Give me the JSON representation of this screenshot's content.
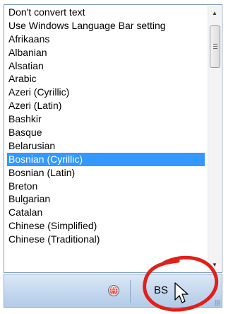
{
  "language_list": {
    "items": [
      "Don't convert text",
      "Use Windows Language Bar setting",
      "Afrikaans",
      "Albanian",
      "Alsatian",
      "Arabic",
      "Azeri (Cyrillic)",
      "Azeri (Latin)",
      "Bashkir",
      "Basque",
      "Belarusian",
      "Bosnian (Cyrillic)",
      "Bosnian (Latin)",
      "Breton",
      "Bulgarian",
      "Catalan",
      "Chinese (Simplified)",
      "Chinese (Traditional)"
    ],
    "selected_index": 11
  },
  "language_bar": {
    "code": "BS",
    "globe_icon": "globe-icon"
  },
  "colors": {
    "selection": "#3399ff",
    "annotation": "#e0201a"
  }
}
